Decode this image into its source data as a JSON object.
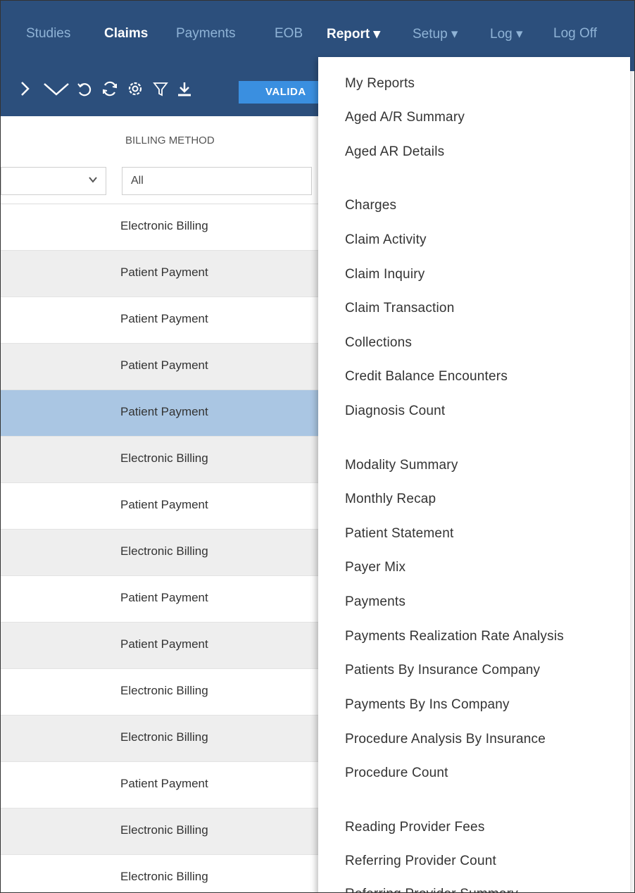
{
  "nav": {
    "items": [
      {
        "label": "Studies",
        "active": false
      },
      {
        "label": "Claims",
        "active": true
      },
      {
        "label": "Payments",
        "active": false
      },
      {
        "label": "EOB",
        "active": false
      },
      {
        "label": "Report ▾",
        "active": true
      },
      {
        "label": "Setup ▾",
        "active": false
      },
      {
        "label": "Log ▾",
        "active": false
      },
      {
        "label": "Log Off",
        "active": false
      }
    ]
  },
  "toolbar": {
    "icons": [
      "chevron-right-icon",
      "chevron-down-icon",
      "undo-icon",
      "refresh-icon",
      "settings-icon",
      "filter-icon",
      "download-icon"
    ],
    "validate_label": "VALIDA"
  },
  "grid": {
    "column_header": "BILLING METHOD",
    "filter_value": "All",
    "rows": [
      {
        "billing_method": "Electronic Billing"
      },
      {
        "billing_method": "Patient Payment"
      },
      {
        "billing_method": "Patient Payment"
      },
      {
        "billing_method": "Patient Payment"
      },
      {
        "billing_method": "Patient Payment"
      },
      {
        "billing_method": "Electronic Billing"
      },
      {
        "billing_method": "Patient Payment"
      },
      {
        "billing_method": "Electronic Billing"
      },
      {
        "billing_method": "Patient Payment"
      },
      {
        "billing_method": "Patient Payment"
      },
      {
        "billing_method": "Electronic Billing"
      },
      {
        "billing_method": "Electronic Billing"
      },
      {
        "billing_method": "Patient Payment"
      },
      {
        "billing_method": "Electronic Billing"
      },
      {
        "billing_method": "Electronic Billing"
      }
    ]
  },
  "report_menu": {
    "items": [
      "My Reports",
      "Aged A/R Summary",
      "Aged AR Details",
      "Charges",
      "Claim Activity",
      "Claim Inquiry",
      "Claim Transaction",
      "Collections",
      "Credit Balance Encounters",
      "Diagnosis Count",
      "Modality Summary",
      "Monthly Recap",
      "Patient Statement",
      "Payer Mix",
      "Payments",
      "Payments Realization Rate Analysis",
      "Patients By Insurance Company",
      "Payments By Ins Company",
      "Procedure Analysis By Insurance",
      "Procedure Count",
      "Reading Provider Fees",
      "Referring Provider Count",
      "Referring Provider Summary"
    ]
  }
}
